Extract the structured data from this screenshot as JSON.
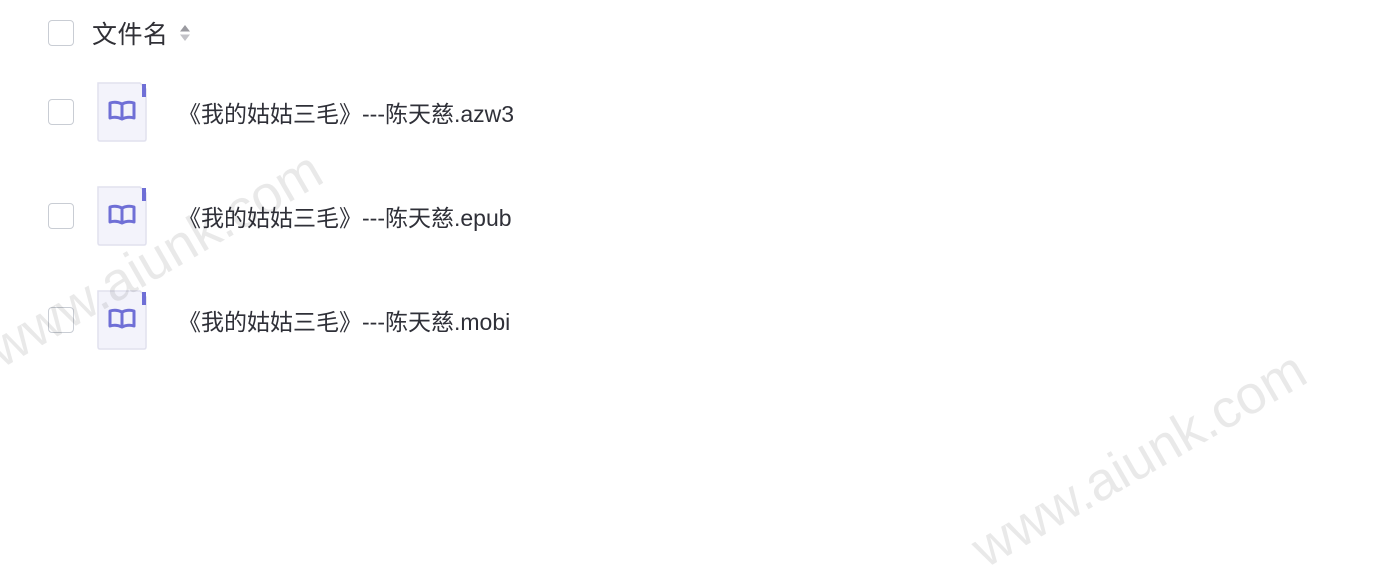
{
  "header": {
    "column_label": "文件名",
    "sort_icon": "sort-updown-icon"
  },
  "files": [
    {
      "name": "《我的姑姑三毛》---陈天慈.azw3",
      "icon": "ebook-file-icon"
    },
    {
      "name": "《我的姑姑三毛》---陈天慈.epub",
      "icon": "ebook-file-icon"
    },
    {
      "name": "《我的姑姑三毛》---陈天慈.mobi",
      "icon": "ebook-file-icon"
    }
  ],
  "watermarks": [
    "www.aiunk.com",
    "www.aiunk.com"
  ],
  "colors": {
    "icon_bg": "#f3f3fb",
    "icon_accent": "#6f6fd6",
    "checkbox_border": "#c9cdd4"
  }
}
